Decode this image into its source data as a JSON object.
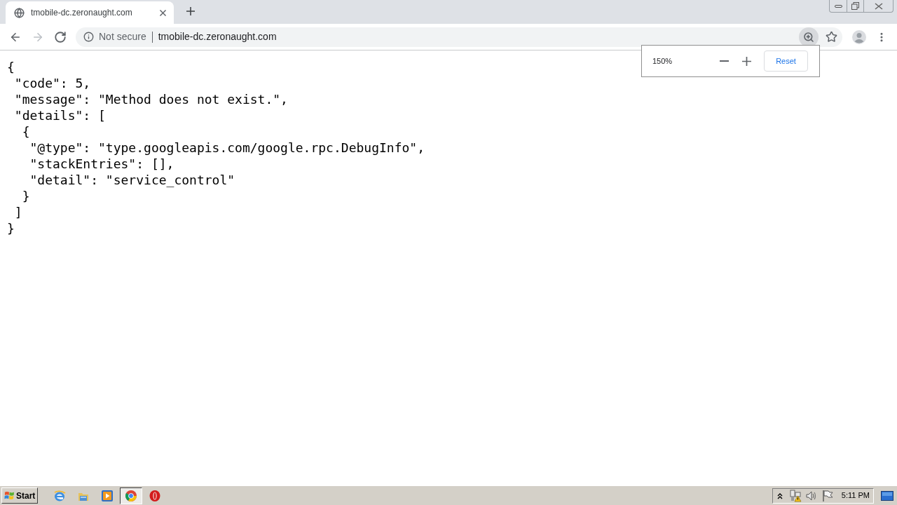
{
  "browser": {
    "tabs": [
      {
        "title": "tmobile-dc.zeronaught.com",
        "selected": true
      }
    ],
    "nav_buttons": [
      {
        "kind": "back",
        "disabled": false
      },
      {
        "kind": "forward",
        "disabled": true
      },
      {
        "kind": "reload",
        "disabled": false
      }
    ],
    "address_bar": {
      "security_label": "Not secure",
      "url": "tmobile-dc.zeronaught.com"
    },
    "omnibox_actions": [
      {
        "kind": "zoom",
        "active": true
      },
      {
        "kind": "bookmark",
        "active": false
      }
    ],
    "zoom_popup": {
      "level_text": "150%",
      "reset_label": "Reset"
    }
  },
  "page": {
    "json_lines": [
      {
        "text": "{",
        "children": [
          {
            "text": "\"code\": 5,"
          },
          {
            "text": "\"message\": \"Method does not exist.\","
          },
          {
            "text": "\"details\": [",
            "children": [
              {
                "text": "{",
                "children": [
                  {
                    "text": "\"@type\": \"type.googleapis.com/google.rpc.DebugInfo\","
                  },
                  {
                    "text": "\"stackEntries\": [],"
                  },
                  {
                    "text": "\"detail\": \"service_control\""
                  }
                ]
              },
              {
                "text": "}"
              }
            ]
          },
          {
            "text": "]"
          }
        ]
      },
      {
        "text": "}"
      }
    ]
  },
  "taskbar": {
    "start_label": "Start",
    "apps": [
      {
        "kind": "e-logo",
        "selected": false
      },
      {
        "kind": "folder",
        "selected": false
      },
      {
        "kind": "play",
        "selected": false
      },
      {
        "kind": "round-logo",
        "selected": true
      },
      {
        "kind": "o-logo",
        "selected": false
      }
    ],
    "clock": "5:11 PM"
  }
}
